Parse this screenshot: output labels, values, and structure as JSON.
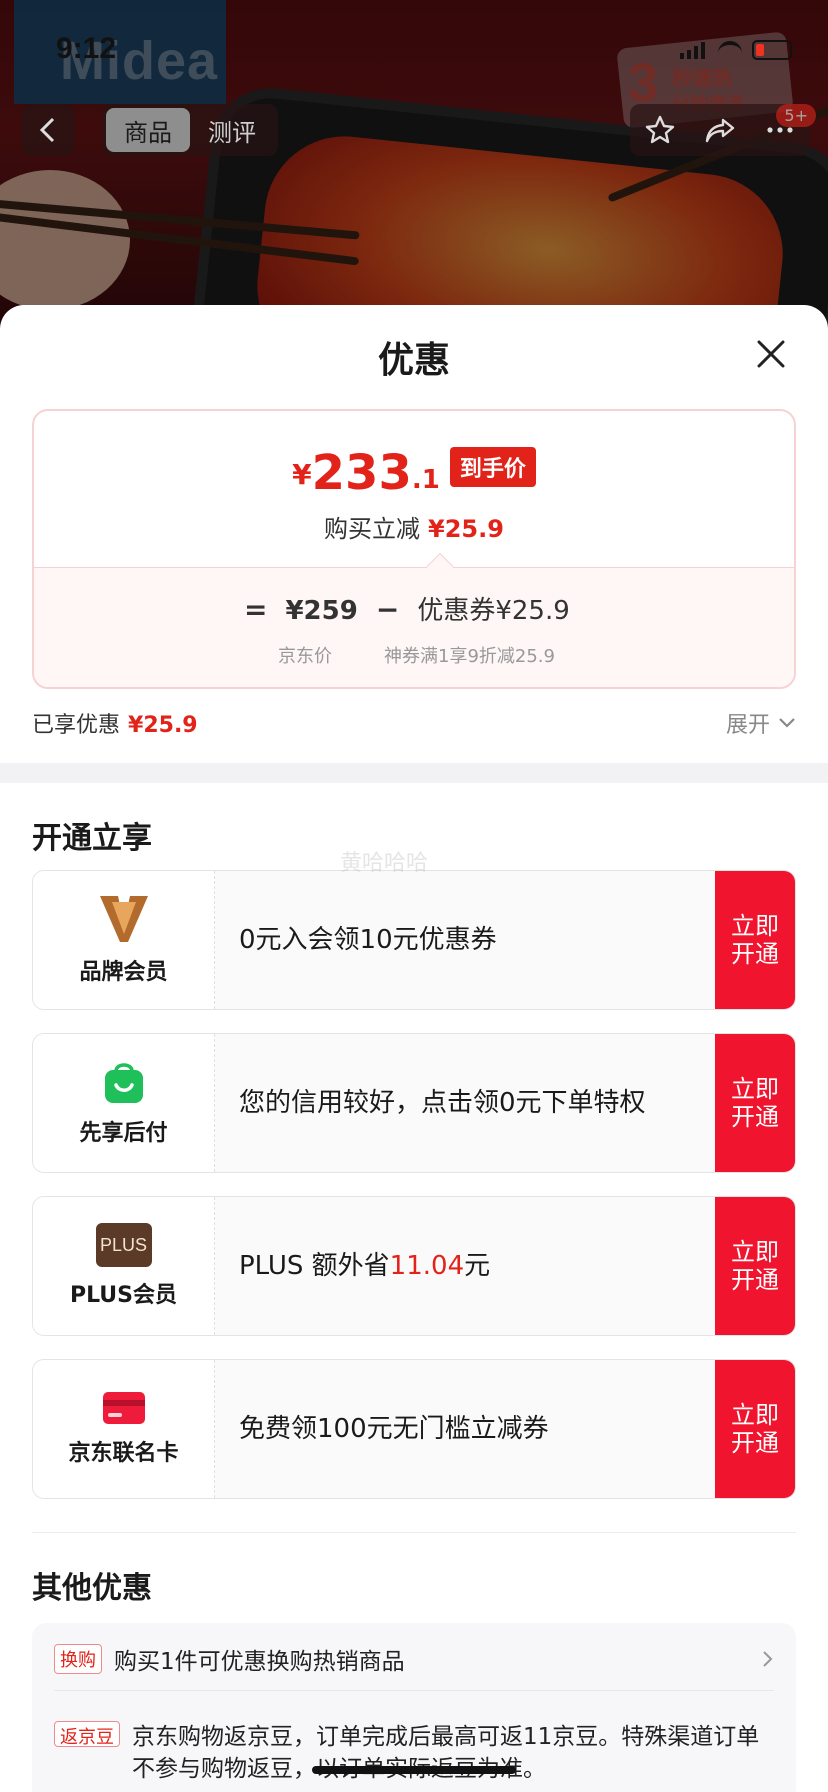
{
  "status_bar": {
    "time": "9:12"
  },
  "hero": {
    "brand_logo": "Midea",
    "promo_number": "3",
    "promo_line1": "秒速热",
    "promo_line2": "分钟速沸"
  },
  "nav": {
    "tabs": [
      {
        "label": "商品",
        "active": true
      },
      {
        "label": "测评",
        "active": false
      }
    ],
    "badge": "5+"
  },
  "sheet": {
    "title": "优惠",
    "price_card": {
      "currency": "¥",
      "price_int": "233",
      "price_dec": ".1",
      "price_tag": "到手价",
      "reduce_label": "购买立减",
      "reduce_amount": "¥25.9",
      "formula_eq": "=",
      "formula_base": "¥259",
      "formula_minus": "−",
      "formula_coupon": "优惠券¥25.9",
      "base_caption": "京东价",
      "coupon_caption": "神券满1享9折减25.9"
    },
    "enjoyed_label": "已享优惠",
    "enjoyed_amount": "¥25.9",
    "expand_label": "展开",
    "open_section_title": "开通立享",
    "members": [
      {
        "name": "品牌会员",
        "icon": "v-brand-icon",
        "desc_pre": "0元入会领10元优惠券",
        "desc_hl": "",
        "desc_post": "",
        "button": "立即开通"
      },
      {
        "name": "先享后付",
        "icon": "shopping-bag-icon",
        "desc_pre": "您的信用较好，点击领0元下单特权",
        "desc_hl": "",
        "desc_post": "",
        "button": "立即开通"
      },
      {
        "name": "PLUS会员",
        "icon": "plus-icon",
        "icon_text": "PLUS",
        "desc_pre": "PLUS 额外省",
        "desc_hl": "11.04",
        "desc_post": "元",
        "button": "立即开通"
      },
      {
        "name": "京东联名卡",
        "icon": "credit-card-icon",
        "desc_pre": "免费领100元无门槛立减券",
        "desc_hl": "",
        "desc_post": "",
        "button": "立即开通"
      }
    ],
    "other_section_title": "其他优惠",
    "other": [
      {
        "tag": "换购",
        "text": "购买1件可优惠换购热销商品"
      },
      {
        "tag": "返京豆",
        "text": "京东购物返京豆，订单完成后最高可返11京豆。特殊渠道订单不参与购物返豆，以订单实际返豆为准。"
      }
    ],
    "watermark": "黄哈哈哈"
  },
  "colors": {
    "accent": "#e2231a",
    "button": "#f0142e"
  }
}
